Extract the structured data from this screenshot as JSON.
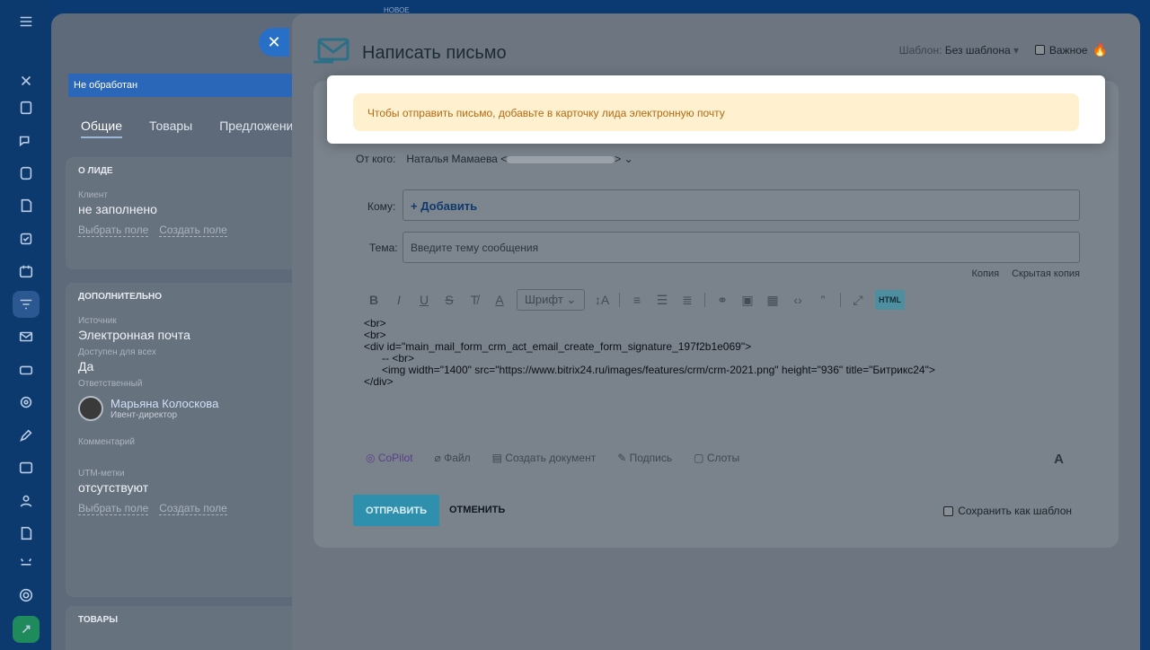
{
  "top": {
    "new_label": "НОВОЕ"
  },
  "crm": {
    "status": "Не обработан",
    "tabs": [
      "Общие",
      "Товары",
      "Предложения"
    ],
    "about": {
      "title": "О ЛИДЕ",
      "client_label": "Клиент",
      "client_value": "не заполнено",
      "link_choose": "Выбрать поле",
      "link_create": "Создать поле"
    },
    "extra": {
      "title": "ДОПОЛНИТЕЛЬНО",
      "source_label": "Источник",
      "source_value": "Электронная почта",
      "available_label": "Доступен для всех",
      "available_value": "Да",
      "responsible_label": "Ответственный",
      "responsible_name": "Марьяна Колоскова",
      "responsible_role": "Ивент-директор",
      "comment_label": "Комментарий",
      "utm_label": "UTM-метки",
      "utm_value": "отсутствуют",
      "link_choose": "Выбрать поле",
      "link_create": "Создать поле"
    },
    "goods": {
      "title": "ТОВАРЫ"
    }
  },
  "panel": {
    "title": "Написать письмо",
    "template_label": "Шаблон:",
    "template_value": "Без шаблона",
    "important_label": "Важное"
  },
  "warning": "Чтобы отправить письмо, добавьте в карточку лида электронную почту",
  "form": {
    "from_label": "От кого:",
    "from_name": "Наталья Мамаева <",
    "from_tail": ">",
    "to_label": "Кому:",
    "to_add": "+ Добавить",
    "subject_label": "Тема:",
    "subject_placeholder": "Введите тему сообщения",
    "cc": "Копия",
    "bcc": "Скрытая копия",
    "font_select": "Шрифт",
    "html_label": "HTML",
    "code": "<br>\n<br>\n<div id=\"main_mail_form_crm_act_email_create_form_signature_197f2b1e069\">\n      -- <br>\n      <img width=\"1400\" src=\"https://www.bitrix24.ru/images/features/crm/crm-2021.png\" height=\"936\" title=\"Битрикс24\">\n</div>",
    "tools": {
      "copilot": "CoPilot",
      "file": "Файл",
      "doc": "Создать документ",
      "sign": "Подпись",
      "slots": "Слоты"
    },
    "font_a": "A",
    "send": "ОТПРАВИТЬ",
    "cancel": "ОТМЕНИТЬ",
    "save_template": "Сохранить как шаблон"
  },
  "colors": {
    "accent": "#2f90ad",
    "warning_bg": "#fff0cf",
    "warning_text": "#b36a12"
  }
}
